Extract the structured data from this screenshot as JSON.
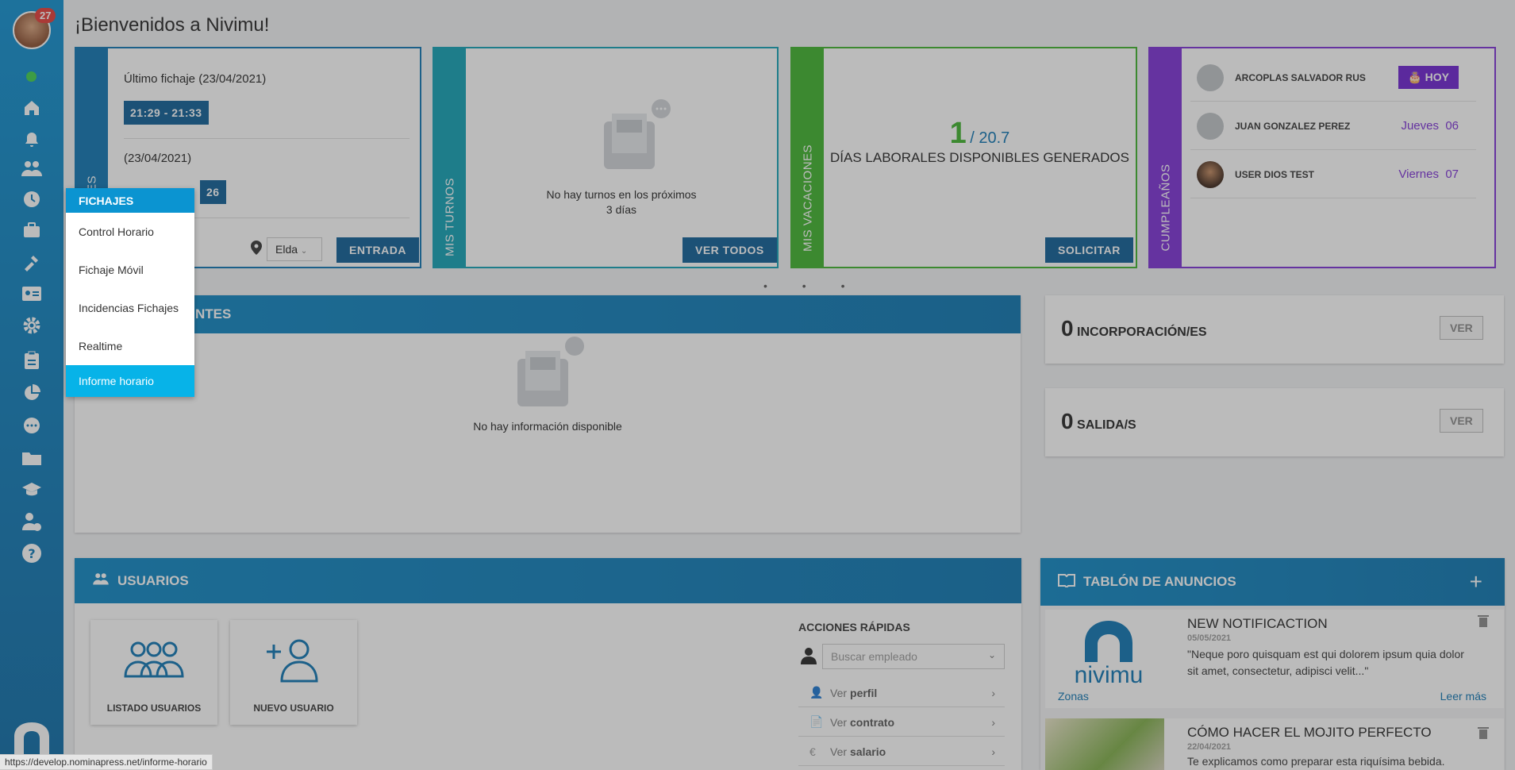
{
  "header": {
    "welcome": "¡Bienvenidos a Nivimu!"
  },
  "sidebar": {
    "notification_count": "27",
    "icons": [
      "home-icon",
      "bell-icon",
      "people-icon",
      "clock-icon",
      "briefcase-icon",
      "tools-icon",
      "id-card-icon",
      "gear-icon",
      "clipboard-icon",
      "pie-chart-icon",
      "chat-icon",
      "folder-icon",
      "graduation-icon",
      "user-money-icon",
      "help-icon"
    ]
  },
  "fichajes_card": {
    "ultimo_label": "Último fichaje (23/04/2021)",
    "time1": "21:29 - 21:33",
    "date2": "(23/04/2021)",
    "time2_partial": "26",
    "strip_label": "ES",
    "location": "Elda",
    "entrada_btn": "ENTRADA"
  },
  "turnos_card": {
    "strip_label": "MIS TURNOS",
    "empty_line1": "No hay turnos en los próximos",
    "empty_line2": "3 días",
    "button": "VER TODOS"
  },
  "vacaciones_card": {
    "strip_label": "MIS VACACIONES",
    "available": "1",
    "total": "/ 20.7",
    "caption": "DÍAS LABORALES DISPONIBLES GENERADOS",
    "button": "SOLICITAR"
  },
  "cumple_card": {
    "strip_label": "CUMPLEAÑOS",
    "rows": [
      {
        "name": "ARCOPLAS SALVADOR RUS",
        "badge": "HOY"
      },
      {
        "name": "JUAN GONZALEZ PEREZ",
        "day": "Jueves",
        "num": "06"
      },
      {
        "name": "USER DIOS TEST",
        "day": "Viernes",
        "num": "07"
      }
    ]
  },
  "pendientes_panel": {
    "title_partial": "NTES",
    "empty": "No hay información disponible"
  },
  "incorporaciones": {
    "count": "0",
    "label": "INCORPORACIÓN/ES",
    "button": "VER"
  },
  "salidas": {
    "count": "0",
    "label": "SALIDA/S",
    "button": "VER"
  },
  "usuarios_panel": {
    "title": "USUARIOS",
    "tile1": "LISTADO USUARIOS",
    "tile2": "NUEVO USUARIO",
    "quick_title": "ACCIONES RÁPIDAS",
    "search_placeholder": "Buscar empleado",
    "quick_items": [
      {
        "prefix": "Ver",
        "bold": "perfil"
      },
      {
        "prefix": "Ver",
        "bold": "contrato"
      },
      {
        "prefix": "Ver",
        "bold": "salario"
      }
    ]
  },
  "anuncios_panel": {
    "title": "TABLÓN DE ANUNCIOS",
    "items": [
      {
        "title": "NEW NOTIFICACTION",
        "date": "05/05/2021",
        "text": "\"Neque poro quisquam est qui dolorem ipsum quia dolor sit amet, consectetur, adipisci velit...\"",
        "tag": "Zonas",
        "more": "Leer más",
        "logo_text": "nivimu"
      },
      {
        "title": "CÓMO HACER EL MOJITO PERFECTO",
        "date": "22/04/2021",
        "text": "Te explicamos como preparar esta riquísima bebida."
      }
    ]
  },
  "fichajes_menu": {
    "header": "FICHAJES",
    "items": [
      "Control Horario",
      "Fichaje Móvil",
      "Incidencias Fichajes",
      "Realtime",
      "Informe horario"
    ]
  },
  "status_url": "https://develop.nominapress.net/informe-horario",
  "colors": {
    "primary": "#0b5c96",
    "teal": "#0fa0b4",
    "green": "#3cb22a",
    "purple": "#7b2fd6"
  }
}
